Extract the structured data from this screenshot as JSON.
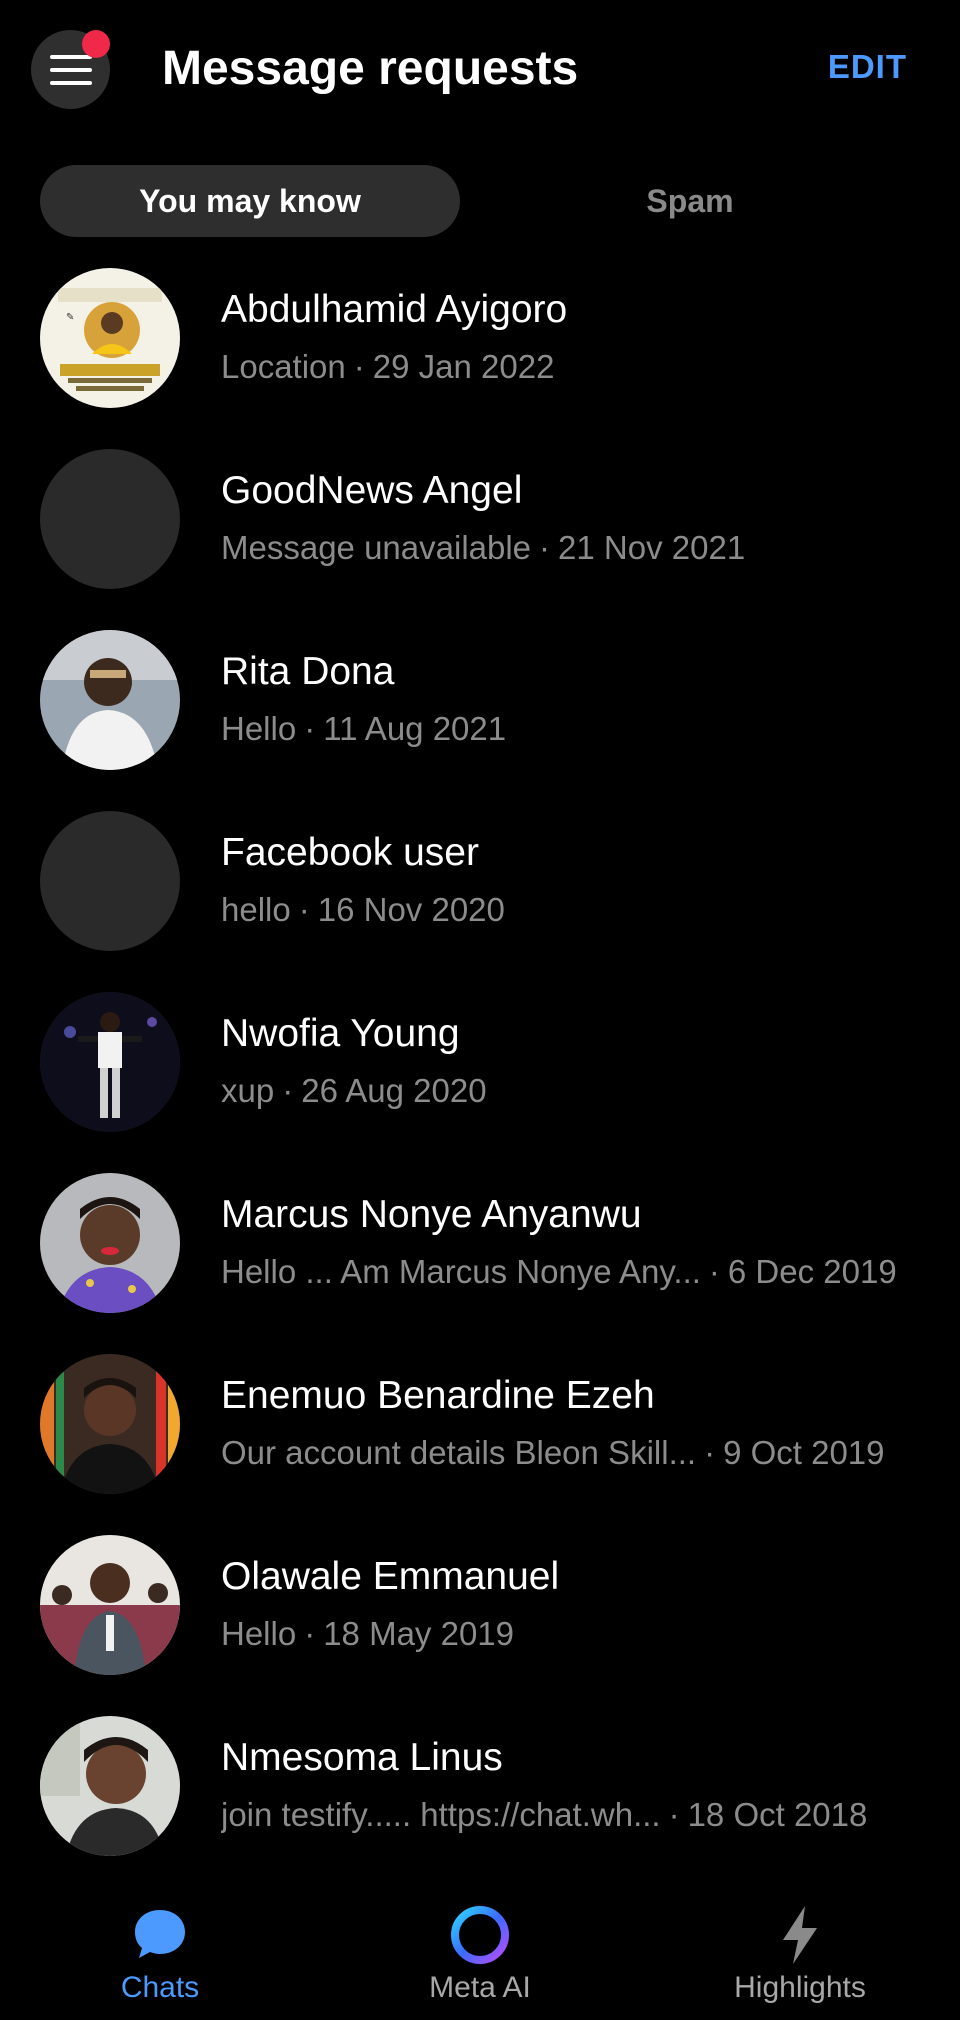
{
  "header": {
    "title": "Message requests",
    "edit_label": "EDIT",
    "menu_icon": "hamburger-menu-icon",
    "has_notification": true
  },
  "tabs": [
    {
      "label": "You may know",
      "active": true
    },
    {
      "label": "Spam",
      "active": false
    }
  ],
  "requests": [
    {
      "name": "Abdulhamid Ayigoro",
      "snippet": "Location",
      "date": "29 Jan 2022",
      "avatar": "photo"
    },
    {
      "name": "GoodNews Angel",
      "snippet": "Message unavailable",
      "date": "21 Nov 2021",
      "avatar": "blank"
    },
    {
      "name": "Rita Dona",
      "snippet": "Hello",
      "date": "11 Aug 2021",
      "avatar": "photo"
    },
    {
      "name": "Facebook user",
      "snippet": "hello",
      "date": "16 Nov 2020",
      "avatar": "blank"
    },
    {
      "name": "Nwofia Young",
      "snippet": "xup",
      "date": "26 Aug 2020",
      "avatar": "photo"
    },
    {
      "name": "Marcus Nonye Anyanwu",
      "snippet": "Hello ... Am Marcus Nonye Any...",
      "date": "6 Dec 2019",
      "avatar": "photo"
    },
    {
      "name": "Enemuo Benardine Ezeh",
      "snippet": "Our account details  Bleon Skill...",
      "date": "9 Oct 2019",
      "avatar": "photo"
    },
    {
      "name": "Olawale Emmanuel",
      "snippet": "Hello",
      "date": "18 May 2019",
      "avatar": "photo"
    },
    {
      "name": "Nmesoma Linus",
      "snippet": "join testify..... https://chat.wh...",
      "date": "18 Oct 2018",
      "avatar": "photo"
    }
  ],
  "separator": "·",
  "bottom_nav": [
    {
      "label": "Chats",
      "icon": "chat-bubble-icon",
      "active": true
    },
    {
      "label": "Meta AI",
      "icon": "meta-ai-ring-icon",
      "active": false
    },
    {
      "label": "Highlights",
      "icon": "lightning-bolt-icon",
      "active": false
    }
  ],
  "colors": {
    "background": "#000000",
    "accent": "#4d9aff",
    "notification": "#f02849",
    "secondary_text": "#8c8c8c",
    "tab_active_bg": "#2e2e2e"
  }
}
